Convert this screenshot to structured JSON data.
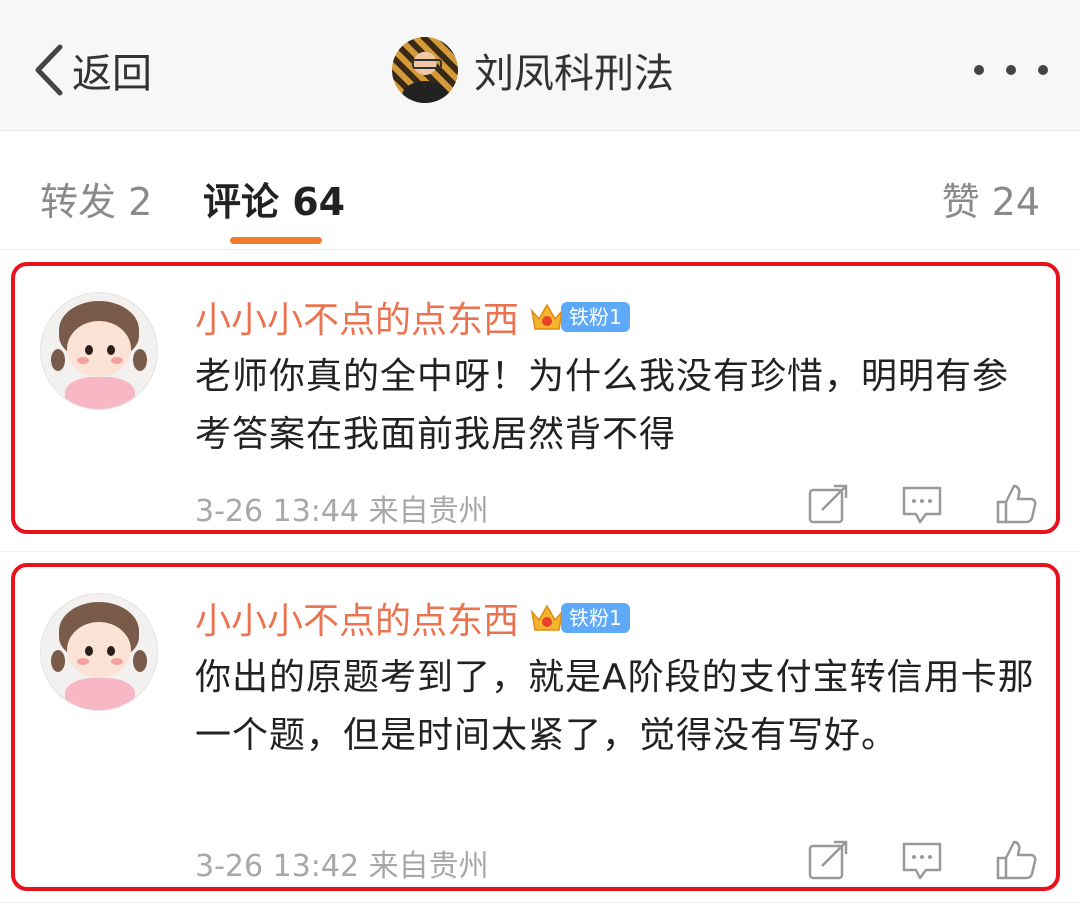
{
  "header": {
    "back_label": "返回",
    "profile_name": "刘凤科刑法"
  },
  "tabs": {
    "repost": "转发 2",
    "comment": "评论 64",
    "like": "赞 24"
  },
  "comments": [
    {
      "username": "小小小不点的点东西",
      "badge": "铁粉1",
      "text": "老师你真的全中呀！为什么我没有珍惜，明明有参考答案在我面前我居然背不得",
      "meta": "3-26 13:44 来自贵州"
    },
    {
      "username": "小小小不点的点东西",
      "badge": "铁粉1",
      "text": "你出的原题考到了，就是A阶段的支付宝转信用卡那一个题，但是时间太紧了，觉得没有写好。",
      "meta": "3-26 13:42 来自贵州"
    }
  ],
  "colors": {
    "accent": "#f27c2c",
    "username": "#eb7350",
    "highlight_frame": "#e8121c",
    "badge": "#5ea9f8"
  },
  "icons": [
    "chevron-left-icon",
    "more-icon",
    "crown-icon",
    "share-icon",
    "reply-icon",
    "like-icon"
  ]
}
